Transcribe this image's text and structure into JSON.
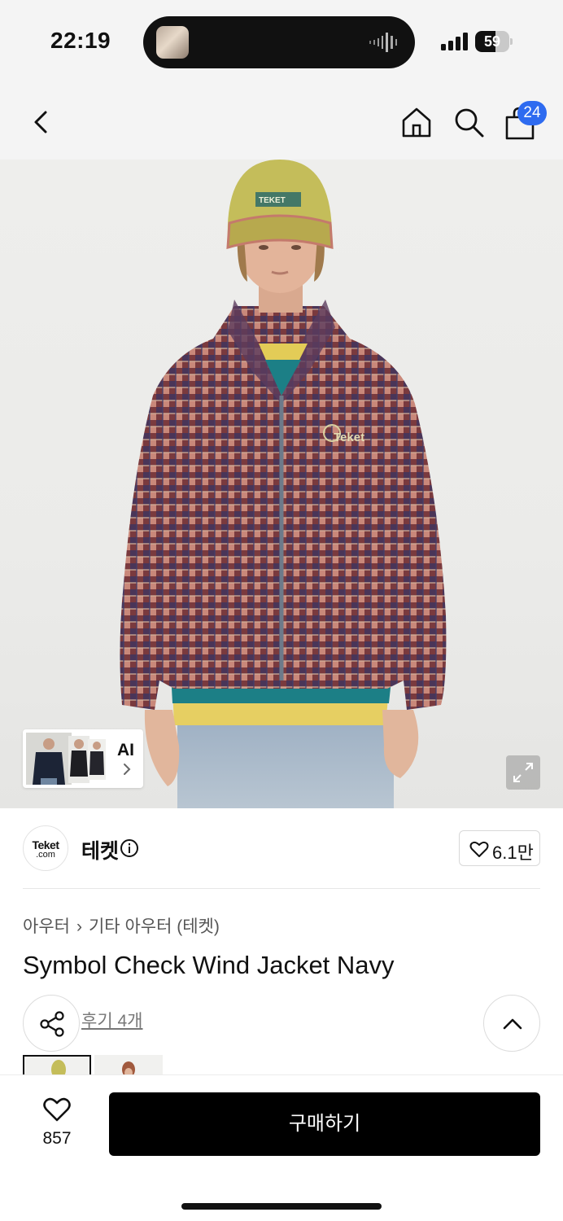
{
  "status_bar": {
    "time": "22:19",
    "battery_level": "59",
    "battery_fraction": 0.59
  },
  "nav": {
    "back_icon": "chevron-left-icon",
    "home_icon": "home-icon",
    "search_icon": "search-icon",
    "bag_icon": "shopping-bag-icon",
    "bag_count": "24",
    "badge_color": "#2e6bf0"
  },
  "gallery": {
    "ai_label": "AI",
    "expand_icon": "expand-icon"
  },
  "brand": {
    "logo_text": "Teket",
    "logo_sub": ".com",
    "name": "테켓",
    "info_icon": "info-icon",
    "like_count": "6.1만"
  },
  "product": {
    "breadcrumb": [
      "아우터",
      "기타 아우터 (테켓)"
    ],
    "title": "Symbol Check Wind Jacket Navy",
    "review_link": "후기 4개"
  },
  "actions": {
    "share_icon": "share-icon",
    "scroll_top_icon": "chevron-up-icon"
  },
  "bottom_bar": {
    "like_count": "857",
    "buy_label": "구매하기",
    "buy_color": "#000000"
  }
}
